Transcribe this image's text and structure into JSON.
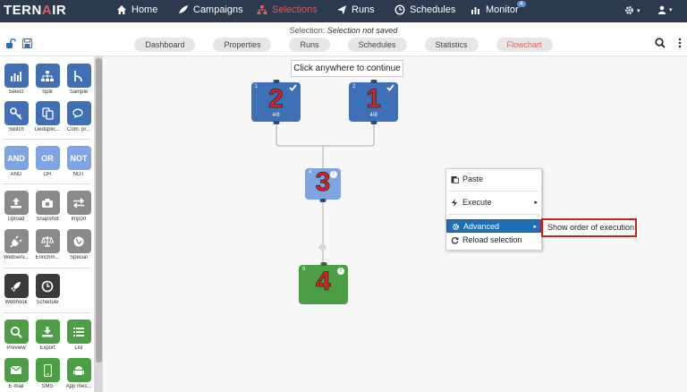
{
  "app": {
    "logo": "TERNAIR"
  },
  "nav": {
    "items": [
      {
        "label": "Home"
      },
      {
        "label": "Campaigns"
      },
      {
        "label": "Selections"
      },
      {
        "label": "Runs"
      },
      {
        "label": "Schedules"
      },
      {
        "label": "Monitor",
        "badge": "4"
      }
    ]
  },
  "selection": {
    "label": "Selection:",
    "status": "Selection not saved"
  },
  "tabs": [
    "Dashboard",
    "Properties",
    "Runs",
    "Schedules",
    "Statistics",
    "Flowchart"
  ],
  "palette": {
    "tools": [
      "Select",
      "Split",
      "Sample",
      "Switch",
      "Deduplic...",
      "Com. pr...",
      "AND",
      "OR",
      "NOT",
      "Upload",
      "Snapshot",
      "Import",
      "Webserv...",
      "Enrichm...",
      "Special",
      "Webhook",
      "Schedule",
      "Preview",
      "Export",
      "List",
      "E-mail",
      "SMS",
      "App mes..."
    ],
    "and_text": "AND",
    "or_text": "OR",
    "not_text": "NOT"
  },
  "canvas": {
    "hint": "Click anywhere to continue",
    "nodes": [
      {
        "id": "1",
        "count": "4/8",
        "step": "2"
      },
      {
        "id": "2",
        "count": "4/8",
        "step": "1"
      },
      {
        "id": "4",
        "step": "3"
      },
      {
        "id": "5",
        "step": "4"
      }
    ]
  },
  "context_menu": {
    "items": [
      "Paste",
      "Execute",
      "Advanced",
      "Reload selection"
    ],
    "submenu": "Show order of execution"
  },
  "colors": {
    "nav_bg": "#2b3a4e",
    "accent_red": "#e25a5a",
    "node_blue": "#3f6fb6",
    "node_green": "#4b9e43",
    "highlight": "#1f6fb8"
  }
}
